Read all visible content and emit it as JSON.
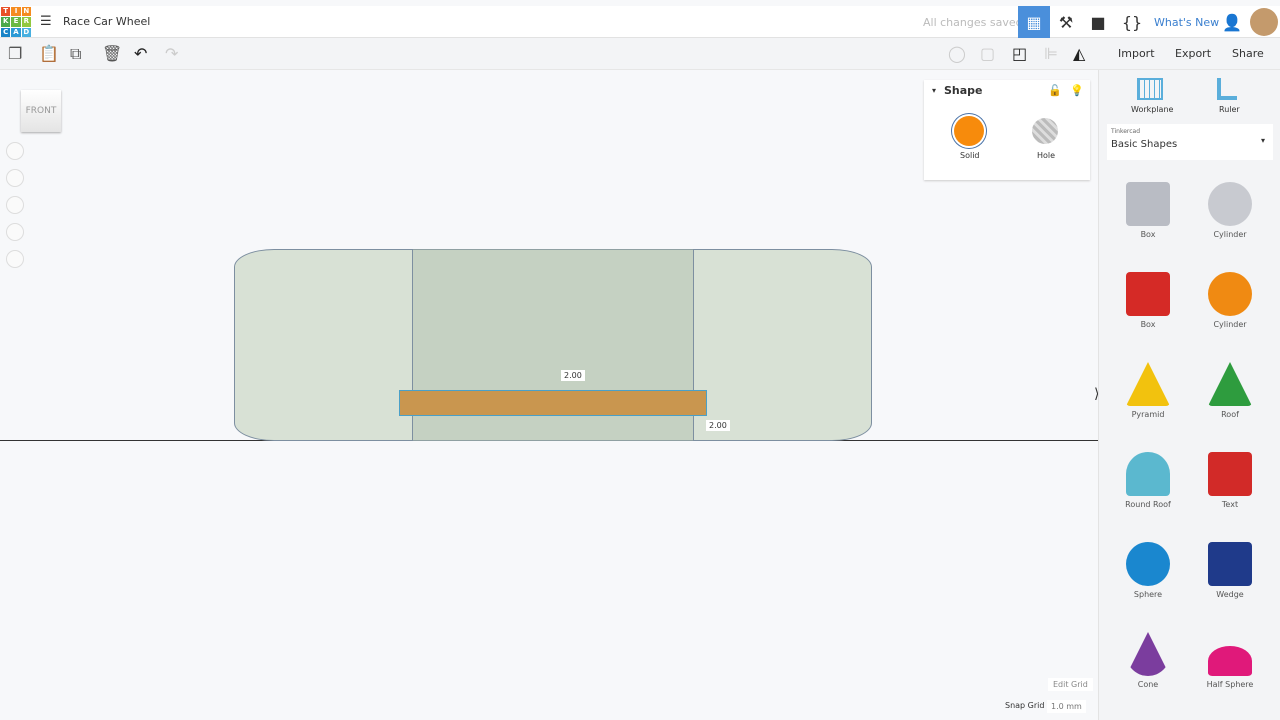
{
  "header": {
    "logo": [
      "T",
      "I",
      "N",
      "K",
      "E",
      "R",
      "C",
      "A",
      "D"
    ],
    "title": "Race Car Wheel",
    "status": "All changes saved",
    "whats_new": "What's New"
  },
  "toolbar": {
    "import": "Import",
    "export": "Export",
    "share": "Share"
  },
  "viewcube": {
    "label": "FRONT"
  },
  "shape_panel": {
    "title": "Shape",
    "solid": "Solid",
    "hole": "Hole"
  },
  "dimensions": {
    "height": "2.00",
    "width": "2.00"
  },
  "right": {
    "workplane": "Workplane",
    "ruler": "Ruler",
    "library_source": "Tinkercad",
    "library": "Basic Shapes",
    "shapes": [
      {
        "label": "Box",
        "color": "#b9bcc4"
      },
      {
        "label": "Cylinder",
        "color": "#c8cad0"
      },
      {
        "label": "Box",
        "color": "#d52a26"
      },
      {
        "label": "Cylinder",
        "color": "#f08a12"
      },
      {
        "label": "Pyramid",
        "color": "#f2c20e"
      },
      {
        "label": "Roof",
        "color": "#2e9c3e"
      },
      {
        "label": "Round Roof",
        "color": "#5bb8cf"
      },
      {
        "label": "Text",
        "color": "#d22a28"
      },
      {
        "label": "Sphere",
        "color": "#1a87cf"
      },
      {
        "label": "Wedge",
        "color": "#1f3a8a"
      },
      {
        "label": "Cone",
        "color": "#7b3d9e"
      },
      {
        "label": "Half Sphere",
        "color": "#e0197a"
      }
    ]
  },
  "grid": {
    "edit": "Edit Grid",
    "snap_label": "Snap Grid",
    "snap_value": "1.0 mm"
  }
}
